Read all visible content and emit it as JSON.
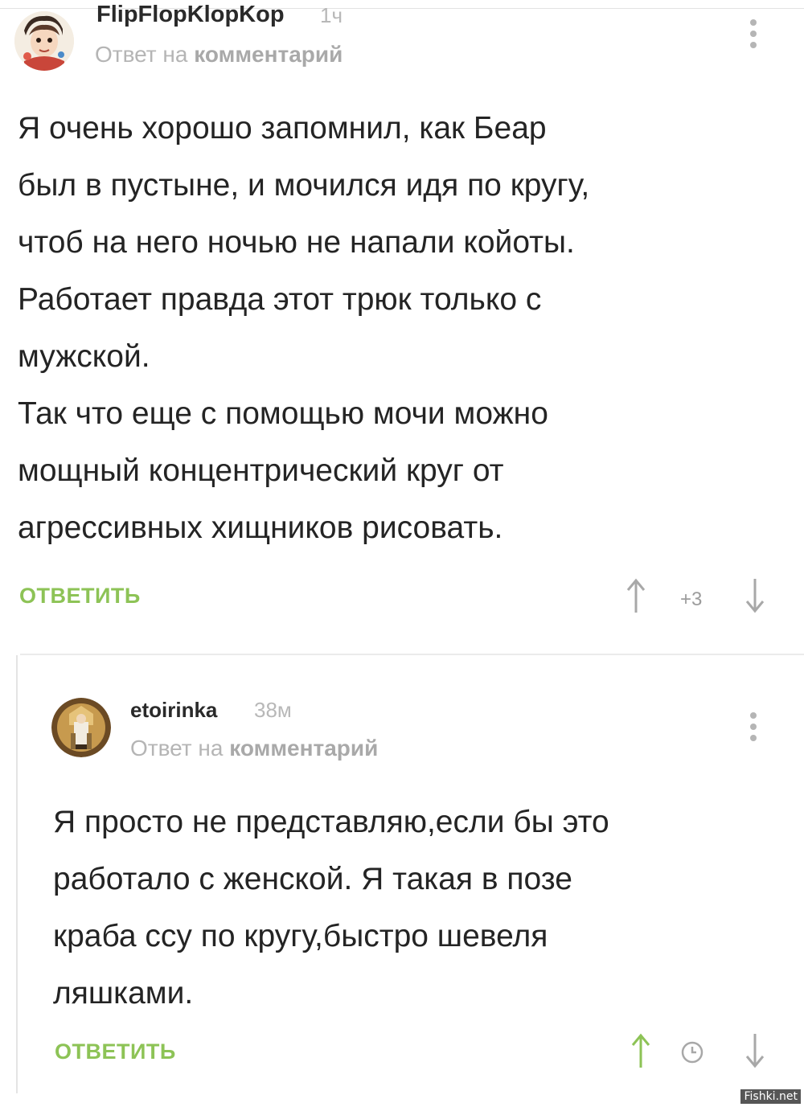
{
  "comments": [
    {
      "username": "FlipFlopKlopKop",
      "time": "1ч",
      "reply_prefix": "Ответ на",
      "reply_target": "комментарий",
      "lines": [
        "Я очень хорошо запомнил, как Беар",
        "был в пустыне, и мочился идя по кругу,",
        "чтоб на него ночью не напали койоты.",
        "Работает правда этот трюк только с",
        "мужской.",
        "Так что еще с помощью мочи можно",
        "мощный концентрический круг от",
        "агрессивных хищников рисовать."
      ],
      "reply_label": "ОТВЕТИТЬ",
      "score": "+3",
      "upvote_icon": "arrow-up-icon",
      "downvote_icon": "arrow-down-icon",
      "more_icon": "more-vertical-icon"
    },
    {
      "username": "etoirinka",
      "time": "38м",
      "reply_prefix": "Ответ на",
      "reply_target": "комментарий",
      "lines": [
        "Я просто не представляю,если бы это",
        "работало с женской. Я такая в позе",
        "краба ссу по кругу,быстро шевеля",
        "ляшками."
      ],
      "reply_label": "ОТВЕТИТЬ",
      "upvote_icon": "arrow-up-icon",
      "timer_icon": "clock-icon",
      "downvote_icon": "arrow-down-icon",
      "more_icon": "more-vertical-icon"
    }
  ],
  "colors": {
    "reply_green": "#8dc356",
    "upvote_active": "#8dc356",
    "muted_gray": "#b5b5b5"
  },
  "watermark": "Fishki.net"
}
